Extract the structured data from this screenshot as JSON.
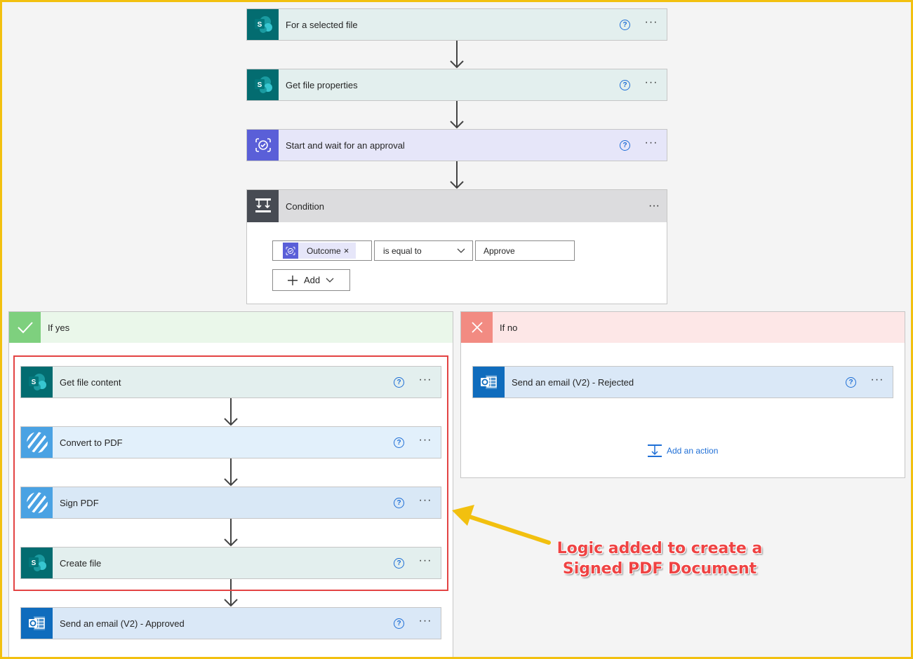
{
  "flow": {
    "trigger": {
      "title": "For a selected file"
    },
    "get_props": {
      "title": "Get file properties"
    },
    "approval": {
      "title": "Start and wait for an approval"
    },
    "condition": {
      "title": "Condition",
      "token_label": "Outcome",
      "token_remove": "×",
      "operator": "is equal to",
      "value": "Approve",
      "add_label": "Add"
    }
  },
  "yes_branch": {
    "label": "If yes",
    "actions": [
      {
        "title": "Get file content"
      },
      {
        "title": "Convert to PDF"
      },
      {
        "title": "Sign PDF"
      },
      {
        "title": "Create file"
      },
      {
        "title": "Send an email (V2) - Approved"
      }
    ]
  },
  "no_branch": {
    "label": "If no",
    "action": {
      "title": "Send an email (V2) - Rejected"
    },
    "add_action_label": "Add an action"
  },
  "annotation": {
    "line1": "Logic added to create a",
    "line2": "Signed PDF Document"
  },
  "common": {
    "help": "?",
    "more": "···"
  },
  "colors": {
    "sharepoint": "#036c70",
    "approvals": "#5a5fd8",
    "pdf": "#4aa2e3",
    "outlook": "#0f6cbd",
    "yes_green": "#7ed07e",
    "no_red": "#f28b82",
    "highlight_red": "#e34343",
    "arrow_yellow": "#f2c00f"
  },
  "icons": [
    "sharepoint-icon",
    "approvals-icon",
    "condition-icon",
    "pdf-stripes-icon",
    "outlook-icon",
    "check-icon",
    "x-icon",
    "help-icon",
    "more-icon",
    "plus-icon",
    "chevron-down-icon",
    "add-action-icon"
  ]
}
